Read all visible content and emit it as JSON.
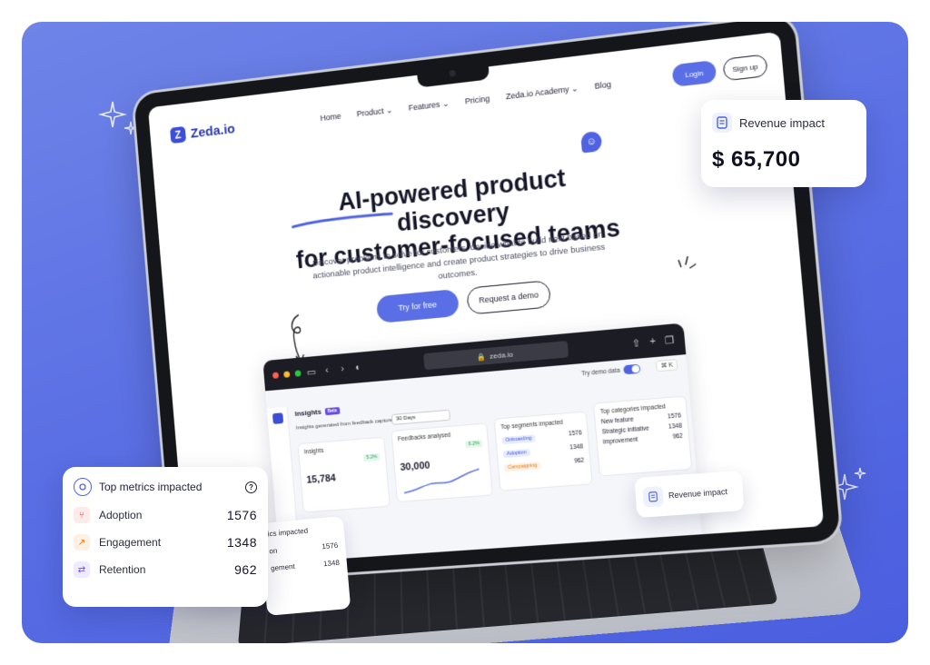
{
  "brand": {
    "name": "Zeda.io"
  },
  "nav": {
    "items": [
      "Home",
      "Product",
      "Features",
      "Pricing",
      "Zeda.io Academy",
      "Blog"
    ],
    "login": "Login",
    "signup": "Sign up"
  },
  "hero": {
    "title_line1": "AI-powered product discovery",
    "title_line2": "for customer-focused teams",
    "subtitle": "Discover problems to solve for customers, decide what to build next based on actionable product intelligence and create product strategies to drive business outcomes.",
    "cta_primary": "Try for free",
    "cta_secondary": "Request a demo"
  },
  "browser": {
    "url": "zeda.io",
    "demo_toggle": "Try demo data",
    "shortcut": "⌘ K",
    "page_title": "Insights",
    "badge": "Beta",
    "subtitle": "Insights generated from feedback captured in",
    "range": "30 Days",
    "cards": {
      "insights": {
        "title": "Insights",
        "value": "15,784",
        "delta": "5.2%"
      },
      "feedbacks": {
        "title": "Feedbacks analysed",
        "value": "30,000",
        "delta": "6.2%"
      },
      "segments": {
        "title": "Top segments impacted",
        "rows": [
          {
            "label": "Onboarding",
            "value": "1576"
          },
          {
            "label": "Adoption",
            "value": "1348"
          },
          {
            "label": "Campaigning",
            "value": "962"
          }
        ]
      },
      "categories": {
        "title": "Top categories impacted",
        "rows": [
          {
            "label": "New feature",
            "value": "1576"
          },
          {
            "label": "Strategic initiative",
            "value": "1348"
          },
          {
            "label": "Improvement",
            "value": "962"
          }
        ]
      }
    }
  },
  "revenue_card": {
    "label": "Revenue impact",
    "value": "$ 65,700"
  },
  "revenue_mini": {
    "label": "Revenue impact"
  },
  "metrics_card": {
    "title": "Top metrics impacted",
    "rows": [
      {
        "label": "Adoption",
        "value": "1576",
        "icon": "branch-icon",
        "color": "#e5484d"
      },
      {
        "label": "Engagement",
        "value": "1348",
        "icon": "trend-icon",
        "color": "#e07a1f"
      },
      {
        "label": "Retention",
        "value": "962",
        "icon": "repeat-icon",
        "color": "#6a4ee0"
      }
    ]
  },
  "partial_card": {
    "title": "ics impacted",
    "rows": [
      {
        "label": "on",
        "value": "1576"
      },
      {
        "label": "gement",
        "value": "1348"
      }
    ]
  },
  "colors": {
    "background": "#5b70e4",
    "accent": "#5a6fe6",
    "card": "#ffffff"
  }
}
